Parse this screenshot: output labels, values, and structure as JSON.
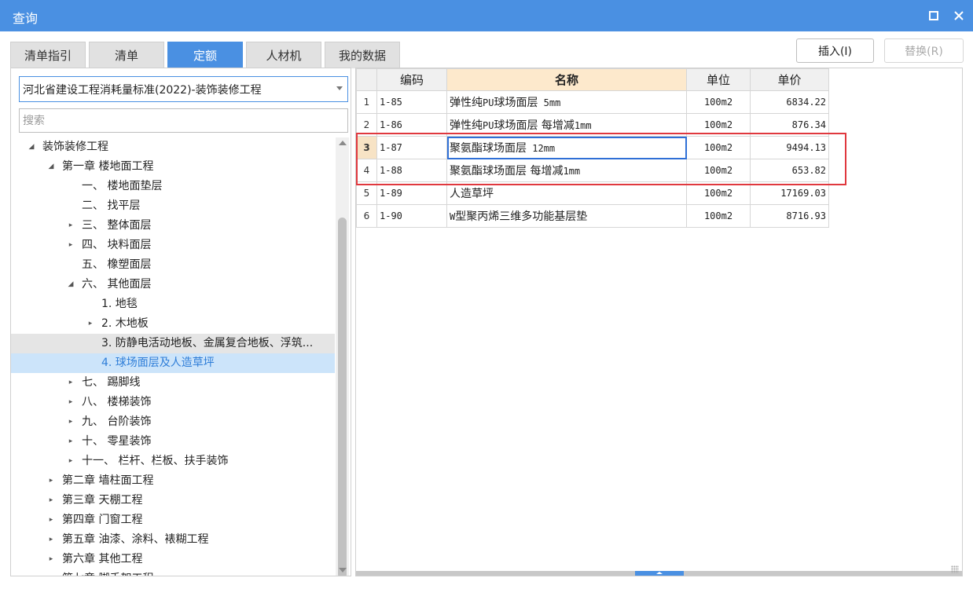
{
  "window": {
    "title": "查询"
  },
  "tabs": [
    {
      "label": "清单指引",
      "active": false
    },
    {
      "label": "清单",
      "active": false
    },
    {
      "label": "定额",
      "active": true
    },
    {
      "label": "人材机",
      "active": false
    },
    {
      "label": "我的数据",
      "active": false
    }
  ],
  "buttons": {
    "insert": "插入(I)",
    "replace": "替换(R)"
  },
  "left": {
    "library_select": "河北省建设工程消耗量标准(2022)-装饰装修工程",
    "search_placeholder": "搜索"
  },
  "tree": [
    {
      "label": "装饰装修工程",
      "toggle": "expanded",
      "level": 0
    },
    {
      "label": "第一章 楼地面工程",
      "toggle": "expanded",
      "level": 1
    },
    {
      "label": "一、 楼地面垫层",
      "toggle": "none",
      "level": 2
    },
    {
      "label": "二、 找平层",
      "toggle": "none",
      "level": 2
    },
    {
      "label": "三、 整体面层",
      "toggle": "collapsed",
      "level": 2
    },
    {
      "label": "四、 块料面层",
      "toggle": "collapsed",
      "level": 2
    },
    {
      "label": "五、 橡塑面层",
      "toggle": "none",
      "level": 2
    },
    {
      "label": "六、 其他面层",
      "toggle": "expanded",
      "level": 2
    },
    {
      "label": "1. 地毯",
      "toggle": "none",
      "level": 3
    },
    {
      "label": "2. 木地板",
      "toggle": "collapsed",
      "level": 3
    },
    {
      "label": "3. 防静电活动地板、金属复合地板、浮筑...",
      "toggle": "none",
      "level": 3,
      "state": "hover"
    },
    {
      "label": "4. 球场面层及人造草坪",
      "toggle": "none",
      "level": 3,
      "state": "selected"
    },
    {
      "label": "七、 踢脚线",
      "toggle": "collapsed",
      "level": 2
    },
    {
      "label": "八、 楼梯装饰",
      "toggle": "collapsed",
      "level": 2
    },
    {
      "label": "九、 台阶装饰",
      "toggle": "collapsed",
      "level": 2
    },
    {
      "label": "十、 零星装饰",
      "toggle": "collapsed",
      "level": 2
    },
    {
      "label": "十一、 栏杆、栏板、扶手装饰",
      "toggle": "collapsed",
      "level": 2
    },
    {
      "label": "第二章 墙柱面工程",
      "toggle": "collapsed",
      "level": 1
    },
    {
      "label": "第三章 天棚工程",
      "toggle": "collapsed",
      "level": 1
    },
    {
      "label": "第四章 门窗工程",
      "toggle": "collapsed",
      "level": 1
    },
    {
      "label": "第五章 油漆、涂料、裱糊工程",
      "toggle": "collapsed",
      "level": 1
    },
    {
      "label": "第六章 其他工程",
      "toggle": "collapsed",
      "level": 1
    },
    {
      "label": "第七章 脚手架工程",
      "toggle": "collapsed",
      "level": 1
    }
  ],
  "grid": {
    "columns": [
      "编码",
      "名称",
      "单位",
      "单价"
    ],
    "rows": [
      {
        "n": "1",
        "code": "1-85",
        "name_prefix": "弹性纯",
        "name_mono": "PU",
        "name_mid": "球场面层",
        "name_mono2": " 5mm",
        "unit": "100m2",
        "price": "6834.22"
      },
      {
        "n": "2",
        "code": "1-86",
        "name_prefix": "弹性纯",
        "name_mono": "PU",
        "name_mid": "球场面层 每增减",
        "name_mono2": "1mm",
        "unit": "100m2",
        "price": "876.34"
      },
      {
        "n": "3",
        "code": "1-87",
        "name_prefix": "聚氨酯球场面层",
        "name_mono": "",
        "name_mid": "",
        "name_mono2": " 12mm",
        "unit": "100m2",
        "price": "9494.13"
      },
      {
        "n": "4",
        "code": "1-88",
        "name_prefix": "聚氨酯球场面层 每增减",
        "name_mono": "",
        "name_mid": "",
        "name_mono2": "1mm",
        "unit": "100m2",
        "price": "653.82"
      },
      {
        "n": "5",
        "code": "1-89",
        "name_prefix": "人造草坪",
        "name_mono": "",
        "name_mid": "",
        "name_mono2": "",
        "unit": "100m2",
        "price": "17169.03"
      },
      {
        "n": "6",
        "code": "1-90",
        "name_prefix": "",
        "name_mono": "W",
        "name_mid": "型聚丙烯三维多功能基层垫",
        "name_mono2": "",
        "unit": "100m2",
        "price": "8716.93"
      }
    ]
  },
  "colors": {
    "accent": "#4a90e2",
    "selection_box": "#e0383e",
    "current_row": "#f7e3c5",
    "sorted_header": "#fde9cc"
  }
}
